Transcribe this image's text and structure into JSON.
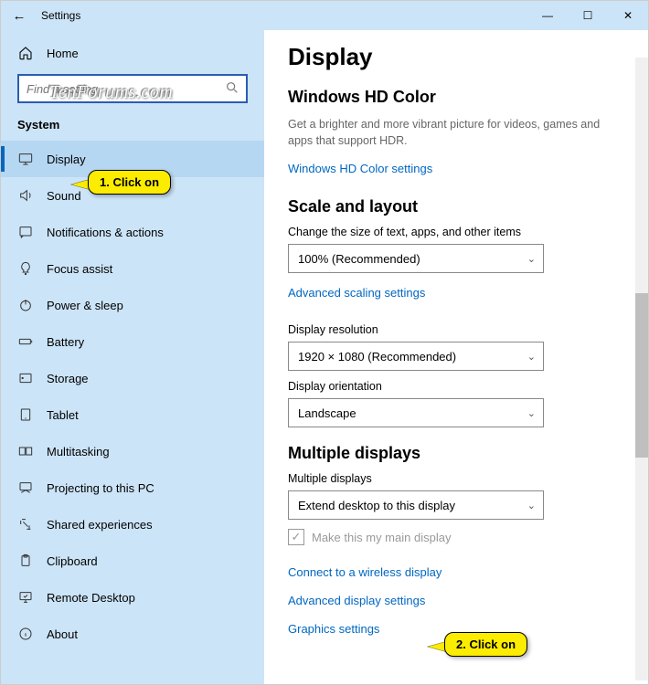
{
  "window": {
    "title": "Settings"
  },
  "sidebar": {
    "home": "Home",
    "search_placeholder": "Find a setting",
    "section": "System",
    "items": [
      {
        "label": "Display",
        "selected": true
      },
      {
        "label": "Sound"
      },
      {
        "label": "Notifications & actions"
      },
      {
        "label": "Focus assist"
      },
      {
        "label": "Power & sleep"
      },
      {
        "label": "Battery"
      },
      {
        "label": "Storage"
      },
      {
        "label": "Tablet"
      },
      {
        "label": "Multitasking"
      },
      {
        "label": "Projecting to this PC"
      },
      {
        "label": "Shared experiences"
      },
      {
        "label": "Clipboard"
      },
      {
        "label": "Remote Desktop"
      },
      {
        "label": "About"
      }
    ]
  },
  "main": {
    "title": "Display",
    "hdcolor": {
      "heading": "Windows HD Color",
      "desc": "Get a brighter and more vibrant picture for videos, games and apps that support HDR.",
      "link": "Windows HD Color settings"
    },
    "scale": {
      "heading": "Scale and layout",
      "size_label": "Change the size of text, apps, and other items",
      "size_value": "100% (Recommended)",
      "adv_link": "Advanced scaling settings",
      "res_label": "Display resolution",
      "res_value": "1920 × 1080 (Recommended)",
      "orient_label": "Display orientation",
      "orient_value": "Landscape"
    },
    "multi": {
      "heading": "Multiple displays",
      "label": "Multiple displays",
      "value": "Extend desktop to this display",
      "checkbox": "Make this my main display",
      "link1": "Connect to a wireless display",
      "link2": "Advanced display settings",
      "link3": "Graphics settings"
    }
  },
  "callouts": {
    "c1": "1. Click on",
    "c2": "2. Click on"
  },
  "watermark": "TenForums.com"
}
